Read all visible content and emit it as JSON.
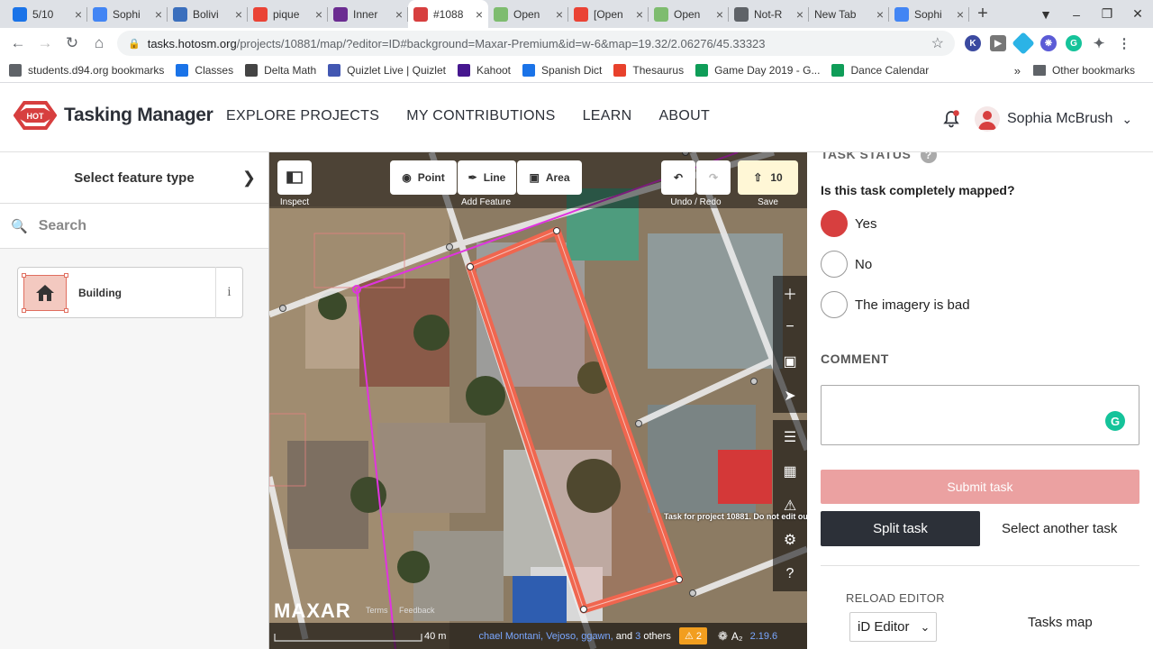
{
  "browser": {
    "tabs": [
      {
        "title": "5/10",
        "color": "#1a73e8",
        "icon": "classes-icon"
      },
      {
        "title": "Sophi",
        "color": "#4285f4",
        "icon": "docs-icon"
      },
      {
        "title": "Bolivi",
        "color": "#3b6fbd",
        "icon": "globe-icon"
      },
      {
        "title": "pique",
        "color": "#ea4335",
        "icon": "google-icon"
      },
      {
        "title": "Inner",
        "color": "#6b2c91",
        "icon": "innerview-icon"
      },
      {
        "title": "#1088",
        "color": "#d73f3f",
        "icon": "hot-icon",
        "active": true
      },
      {
        "title": "Open",
        "color": "#7ebc6f",
        "icon": "osm-icon"
      },
      {
        "title": "[Open",
        "color": "#ea4335",
        "icon": "gmail-icon"
      },
      {
        "title": "Open",
        "color": "#7ebc6f",
        "icon": "osm-icon"
      },
      {
        "title": "Not-R",
        "color": "#5f6368",
        "icon": "globe-icon"
      },
      {
        "title": "New Tab",
        "color": "",
        "icon": ""
      },
      {
        "title": "Sophi",
        "color": "#4285f4",
        "icon": "docs-icon"
      }
    ],
    "url_host": "tasks.hotosm.org",
    "url_path": "/projects/10881/map/?editor=ID#background=Maxar-Premium&id=w-6&map=19.32/2.06276/45.33323",
    "bookmarks": [
      {
        "label": "students.d94.org bookmarks",
        "color": "#5f6368"
      },
      {
        "label": "Classes",
        "color": "#1a73e8"
      },
      {
        "label": "Delta Math",
        "color": "#444"
      },
      {
        "label": "Quizlet Live | Quizlet",
        "color": "#4257b2"
      },
      {
        "label": "Kahoot",
        "color": "#46178f"
      },
      {
        "label": "Spanish Dict",
        "color": "#1a73e8"
      },
      {
        "label": "Thesaurus",
        "color": "#e8412c"
      },
      {
        "label": "Game Day 2019 - G...",
        "color": "#0f9d58"
      },
      {
        "label": "Dance Calendar",
        "color": "#0f9d58"
      }
    ],
    "other_bookmarks": "Other bookmarks"
  },
  "header": {
    "brand": "Tasking Manager",
    "logo_text": "HOT",
    "nav": [
      "EXPLORE PROJECTS",
      "MY CONTRIBUTIONS",
      "LEARN",
      "ABOUT"
    ],
    "user_name": "Sophia McBrush"
  },
  "left_panel": {
    "title": "Select feature type",
    "search_placeholder": "Search",
    "preset": "Building",
    "info": "i"
  },
  "editor": {
    "inspect_label": "Inspect",
    "point": "Point",
    "line": "Line",
    "area": "Area",
    "add_feature_label": "Add Feature",
    "undo_redo_label": "Undo / Redo",
    "save_count": "10",
    "save_label": "Save",
    "task_label": "Task for project 10881. Do not edit ou",
    "maxar": "MAXAR",
    "terms": "Terms",
    "feedback": "Feedback",
    "scale": "40 m",
    "attribution_names": "chael Montani, Vejoso, ggawn,",
    "attribution_and": "and",
    "attribution_count": "3",
    "attribution_others": "others",
    "issues_count": "2",
    "version": "2.19.6"
  },
  "task": {
    "status_title": "TASK STATUS",
    "question": "Is this task completely mapped?",
    "options": [
      "Yes",
      "No",
      "The imagery is bad"
    ],
    "comment_label": "COMMENT",
    "submit": "Submit task",
    "split": "Split task",
    "select_another": "Select another task",
    "reload_editor": "RELOAD EDITOR",
    "editor_choice": "iD Editor",
    "tasks_map": "Tasks map"
  },
  "colors": {
    "accent": "#d73f3f",
    "submit_disabled": "#eba1a1",
    "dark": "#2c3038",
    "selected_area": "#f0664f",
    "boundary": "#e033e0"
  }
}
